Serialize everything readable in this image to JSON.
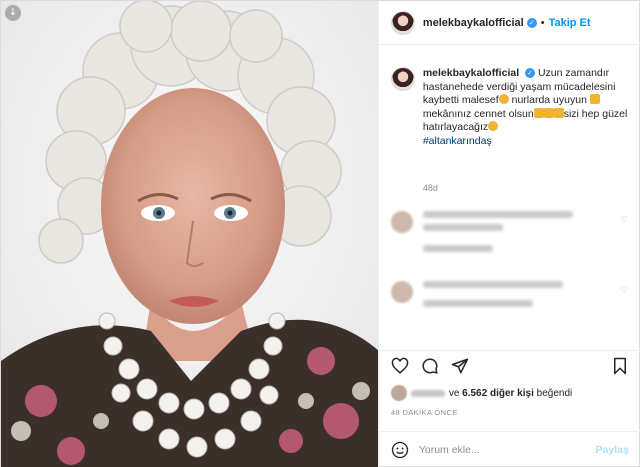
{
  "header": {
    "username": "melekbaykalofficial",
    "separator": "•",
    "follow_label": "Takip Et"
  },
  "caption": {
    "username": "melekbaykalofficial",
    "text_1": "Uzun zamandır hastanehede verdiği yaşam mücadelesini kaybetti malesef",
    "text_2": "nurlarda uyuyun",
    "text_3": "mekânınız cennet olsun",
    "text_4": "sizi hep güzel hatırlayacağız",
    "hashtag": "#altankarındaş",
    "age": "48d"
  },
  "likes": {
    "text_pre": "ve",
    "count_text": "6.562 diğer kişi",
    "text_post": "beğendi"
  },
  "time_ago": "48 DAKİKA ÖNCE",
  "comment_box": {
    "placeholder": "Yorum ekle...",
    "share_label": "Paylaş"
  },
  "icons": {
    "download": "download-icon",
    "verified": "verified-badge-icon",
    "like": "heart-icon",
    "comment": "comment-icon",
    "share": "paper-plane-icon",
    "save": "bookmark-icon",
    "emoji": "smiley-icon"
  },
  "colors": {
    "accent": "#0095f6",
    "verified": "#3897f0",
    "hashtag": "#00376b",
    "muted": "#8e8e8e"
  }
}
